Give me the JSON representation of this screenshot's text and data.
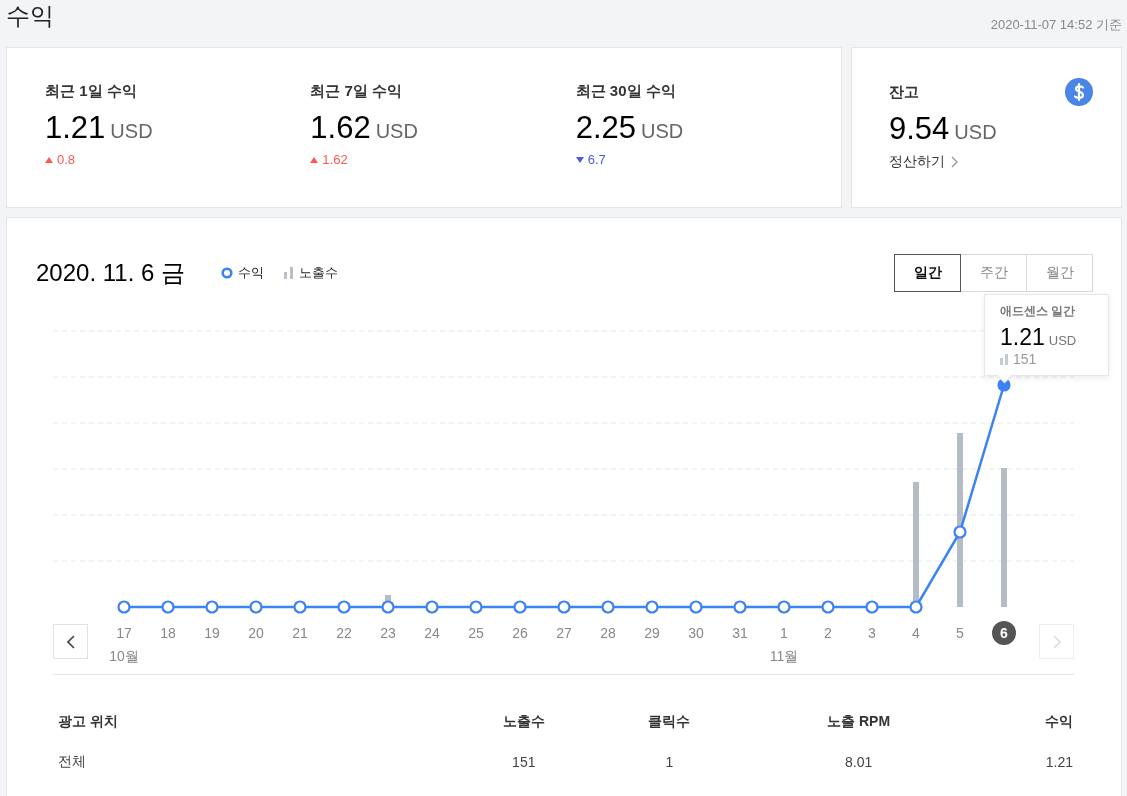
{
  "page": {
    "title": "수익",
    "timestamp": "2020-11-07 14:52 기준"
  },
  "summary": [
    {
      "label": "최근 1일 수익",
      "value": "1.21",
      "unit": "USD",
      "change": "0.8",
      "rising": true
    },
    {
      "label": "최근 7일 수익",
      "value": "1.62",
      "unit": "USD",
      "change": "1.62",
      "rising": true
    },
    {
      "label": "최근 30일 수익",
      "value": "2.25",
      "unit": "USD",
      "change": "6.7",
      "rising": false
    }
  ],
  "balance": {
    "label": "잔고",
    "value": "9.54",
    "unit": "USD",
    "link": "정산하기"
  },
  "chart": {
    "date": "2020. 11. 6 금",
    "legend": [
      {
        "label": "수익",
        "kind": "line"
      },
      {
        "label": "노출수",
        "kind": "bar"
      }
    ],
    "periods": [
      {
        "label": "일간",
        "selected": true
      },
      {
        "label": "주간",
        "selected": false
      },
      {
        "label": "월간",
        "selected": false
      }
    ],
    "days": [
      {
        "label": "17",
        "month": "10월",
        "selected": false
      },
      {
        "label": "18",
        "selected": false
      },
      {
        "label": "19",
        "selected": false
      },
      {
        "label": "20",
        "selected": false
      },
      {
        "label": "21",
        "selected": false
      },
      {
        "label": "22",
        "selected": false
      },
      {
        "label": "23",
        "selected": false
      },
      {
        "label": "24",
        "selected": false
      },
      {
        "label": "25",
        "selected": false
      },
      {
        "label": "26",
        "selected": false
      },
      {
        "label": "27",
        "selected": false
      },
      {
        "label": "28",
        "selected": false
      },
      {
        "label": "29",
        "selected": false
      },
      {
        "label": "30",
        "selected": false
      },
      {
        "label": "31",
        "selected": false
      },
      {
        "label": "1",
        "month": "11월",
        "selected": false
      },
      {
        "label": "2",
        "selected": false
      },
      {
        "label": "3",
        "selected": false
      },
      {
        "label": "4",
        "selected": false
      },
      {
        "label": "5",
        "selected": false
      },
      {
        "label": "6",
        "selected": true
      }
    ],
    "tooltip": {
      "title": "애드센스 일간",
      "value": "1.21",
      "unit": "USD",
      "impressions": "151"
    }
  },
  "table": {
    "columns": [
      "광고 위치",
      "노출수",
      "클릭수",
      "노출 RPM",
      "수익"
    ],
    "rows": [
      [
        "전체",
        "151",
        "1",
        "8.01",
        "1.21"
      ]
    ]
  }
}
